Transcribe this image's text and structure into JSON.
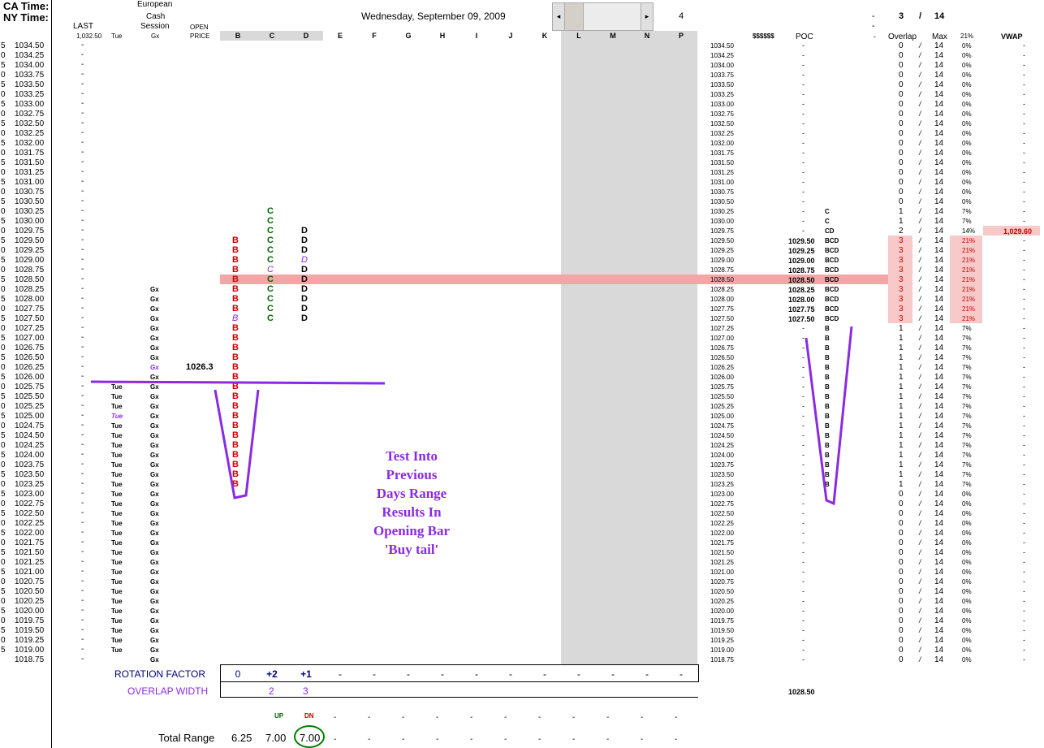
{
  "header": {
    "ca_time_label": "CA Time:",
    "ny_time_label": "NY Time:",
    "date": "Wednesday, September 09, 2009",
    "scroll_value": "4",
    "european_label": "European",
    "cash_session_label": "Cash",
    "session_label": "Session",
    "gx_label": "Gx",
    "last_label": "LAST",
    "last_value": "1,032.50",
    "tue_label": "Tue",
    "open_label": "OPEN",
    "price_label": "PRICE",
    "count_a": "3",
    "count_slash": "/",
    "count_b": "14",
    "dash": "-"
  },
  "columns": [
    "B",
    "C",
    "D",
    "E",
    "F",
    "G",
    "H",
    "I",
    "J",
    "K",
    "L",
    "M",
    "N",
    "P"
  ],
  "right_headers": {
    "dollar": "$$$$$$",
    "poc": "POC",
    "dash": "-",
    "overlap": "Overlap",
    "max": "Max",
    "pct": "21%",
    "vwap": "VWAP"
  },
  "prices": [
    "1034.50",
    "1034.25",
    "1034.00",
    "1033.75",
    "1033.50",
    "1033.25",
    "1033.00",
    "1032.75",
    "1032.50",
    "1032.25",
    "1032.00",
    "1031.75",
    "1031.50",
    "1031.25",
    "1031.00",
    "1030.75",
    "1030.50",
    "1030.25",
    "1030.00",
    "1029.75",
    "1029.50",
    "1029.25",
    "1029.00",
    "1028.75",
    "1028.50",
    "1028.25",
    "1028.00",
    "1027.75",
    "1027.50",
    "1027.25",
    "1027.00",
    "1026.75",
    "1026.50",
    "1026.25",
    "1026.00",
    "1025.75",
    "1025.50",
    "1025.25",
    "1025.00",
    "1024.75",
    "1024.50",
    "1024.25",
    "1024.00",
    "1023.75",
    "1023.50",
    "1023.25",
    "1023.00",
    "1022.75",
    "1022.50",
    "1022.25",
    "1022.00",
    "1021.75",
    "1021.50",
    "1021.25",
    "1021.00",
    "1020.75",
    "1020.50",
    "1020.25",
    "1020.00",
    "1019.75",
    "1019.50",
    "1019.25",
    "1019.00",
    "1018.75"
  ],
  "left_prefix": [
    "5",
    "0",
    "5",
    "0",
    "5",
    "0",
    "5",
    "0",
    "5",
    "0",
    "5",
    "0",
    "5",
    "0",
    "5",
    "0",
    "5",
    "0",
    "5",
    "0",
    "5",
    "0",
    "5",
    "0",
    "5",
    "0",
    "5",
    "0",
    "5",
    "0",
    "5",
    "0",
    "5",
    "0",
    "5",
    "0",
    "5",
    "0",
    "5",
    "0",
    "5",
    "0",
    "5",
    "0",
    "5",
    "0",
    "5",
    "0",
    "5",
    "0",
    "5",
    "0",
    "5",
    "0",
    "5",
    "0",
    "5",
    "0",
    "5",
    "0",
    "5",
    "0",
    "5",
    ""
  ],
  "open_price": "1026.3",
  "poc_prices": [
    "1029.50",
    "1029.25",
    "1029.00",
    "1028.75",
    "1028.50",
    "1028.25",
    "1028.00",
    "1027.75",
    "1027.50"
  ],
  "vwap_value": "1,029.60",
  "annotation": [
    "Test Into",
    "Previous",
    "Days Range",
    "Results In",
    "Opening Bar",
    "'Buy tail'"
  ],
  "rotation": {
    "label": "ROTATION FACTOR",
    "values": [
      "0",
      "+2",
      "+1",
      "-",
      "-",
      "-",
      "-",
      "-",
      "-",
      "-",
      "-",
      "-",
      "-",
      "-"
    ]
  },
  "overlap_width": {
    "label": "OVERLAP WIDTH",
    "values": [
      "2",
      "3"
    ],
    "right_value": "1028.50"
  },
  "updn": {
    "up": "UP",
    "dn": "DN"
  },
  "total_range": {
    "label": "Total Range",
    "values": [
      "6.25",
      "7.00",
      "7.00"
    ],
    "dashes": [
      "-",
      "-",
      "-",
      "-",
      "-",
      "-",
      "-",
      "-",
      "-",
      "-",
      "-"
    ]
  },
  "colors": {
    "red": "#cc0000",
    "green": "#006400",
    "purple": "#8a2be2",
    "navy": "#000080",
    "pink_highlight": "#f4a6a6"
  }
}
